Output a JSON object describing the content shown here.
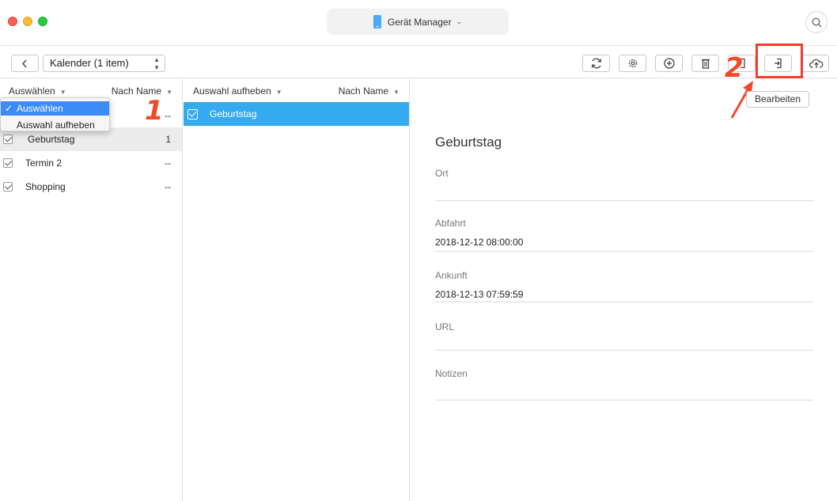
{
  "titlebar": {
    "device_name": "Gerät Manager"
  },
  "toolbar": {
    "calendar_select": "Kalender (1 item)",
    "step_badge": "2"
  },
  "left_pane": {
    "header_select": "Auswählen",
    "header_sort": "Nach Name",
    "step_badge": "1",
    "dropdown": {
      "items": [
        "Auswählen",
        "Auswahl aufheben"
      ],
      "selected": "Auswählen"
    },
    "rows": [
      {
        "label": "",
        "count": "--"
      },
      {
        "label": "Geburtstag",
        "count": "1"
      },
      {
        "label": "Termin 2",
        "count": "--"
      },
      {
        "label": "Shopping",
        "count": "--"
      }
    ]
  },
  "mid_pane": {
    "header_select": "Auswahl aufheben",
    "header_sort": "Nach Name",
    "rows": [
      {
        "label": "Geburtstag"
      }
    ]
  },
  "detail": {
    "edit_label": "Bearbeiten",
    "title": "Geburtstag",
    "fields": [
      {
        "label": "Ort",
        "value": ""
      },
      {
        "label": "Abfahrt",
        "value": "2018-12-12 08:00:00"
      },
      {
        "label": "Ankunft",
        "value": "2018-12-13 07:59:59"
      },
      {
        "label": "URL",
        "value": ""
      },
      {
        "label": "Notizen",
        "value": ""
      }
    ]
  },
  "colors": {
    "accent_blue": "#36aaf0",
    "menu_highlight": "#3b8cf7",
    "annotation_red": "#f23d2b"
  },
  "icons": [
    "back-icon",
    "refresh-icon",
    "settings-icon",
    "add-icon",
    "trash-icon",
    "export-device-icon",
    "export-pc-icon",
    "cloud-upload-icon",
    "search-icon",
    "phone-icon"
  ]
}
